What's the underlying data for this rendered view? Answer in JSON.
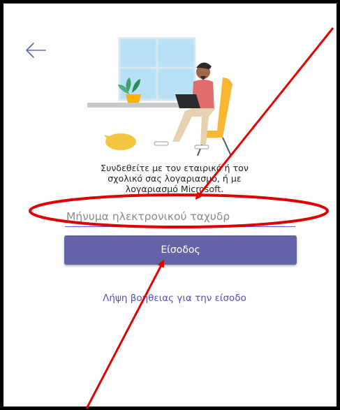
{
  "sign_in": {
    "prompt_line1": "Συνδεθείτε με τον εταιρικό ή τον",
    "prompt_line2": "σχολικό σας λογαριασμό, ή με",
    "prompt_line3": "λογαριασμό Microsoft.",
    "email_placeholder": "Μήνυμα ηλεκτρονικού ταχυδρ",
    "email_value": "",
    "signin_label": "Είσοδος",
    "help_link": "Λήψη βοήθειας για την είσοδο"
  },
  "icons": {
    "back": "back-arrow-icon"
  },
  "colors": {
    "accent": "#6264a7",
    "link": "#4f52b2",
    "annotation": "#e00000",
    "frame": "#000000"
  }
}
